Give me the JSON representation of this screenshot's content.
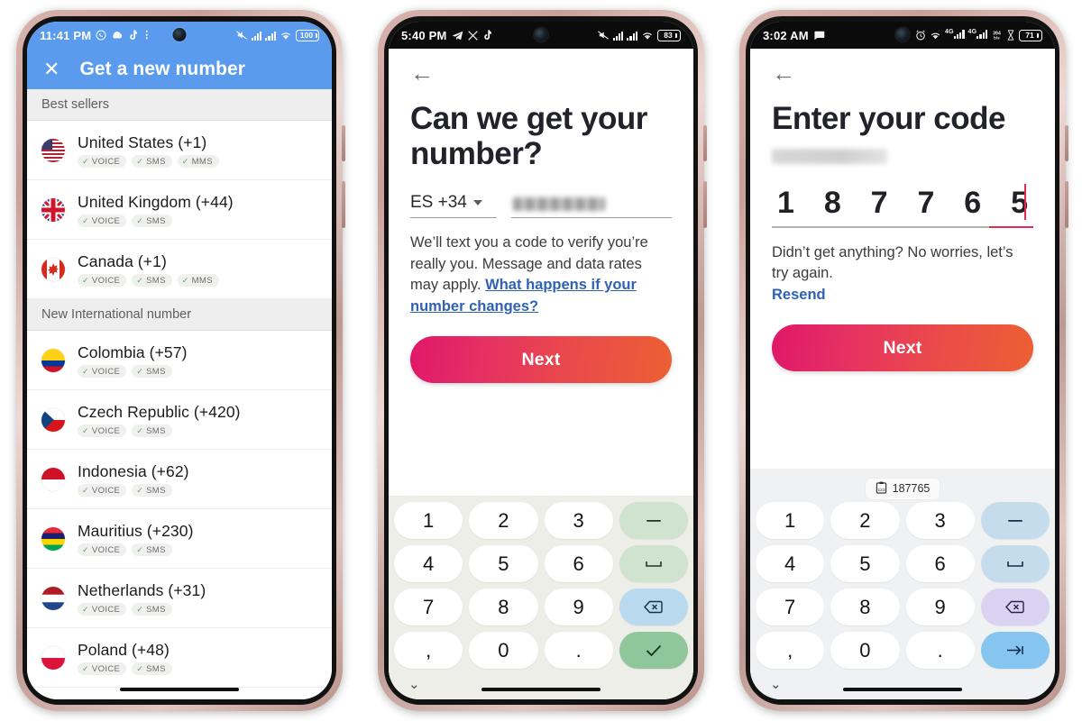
{
  "phones": [
    {
      "id": "phone-country-picker",
      "statusbar": {
        "theme": "blue",
        "time": "11:41 PM",
        "left_icons": [
          "whatsapp-icon",
          "cloud-icon",
          "tiktok-icon",
          "more-icon"
        ],
        "right_icons": [
          "mute-icon",
          "signal-1-icon",
          "signal-2-icon",
          "wifi-icon"
        ],
        "battery": "100"
      },
      "appbar": {
        "close_label": "✕",
        "title": "Get a new number"
      },
      "sections": [
        {
          "header": "Best sellers",
          "countries": [
            {
              "name": "United States (+1)",
              "flag": "us",
              "features": [
                "VOICE",
                "SMS",
                "MMS"
              ]
            },
            {
              "name": "United Kingdom (+44)",
              "flag": "gb",
              "features": [
                "VOICE",
                "SMS"
              ]
            },
            {
              "name": "Canada (+1)",
              "flag": "ca",
              "features": [
                "VOICE",
                "SMS",
                "MMS"
              ]
            }
          ]
        },
        {
          "header": "New International number",
          "countries": [
            {
              "name": "Colombia (+57)",
              "flag": "co",
              "features": [
                "VOICE",
                "SMS"
              ]
            },
            {
              "name": "Czech Republic (+420)",
              "flag": "cz",
              "features": [
                "VOICE",
                "SMS"
              ]
            },
            {
              "name": "Indonesia (+62)",
              "flag": "id",
              "features": [
                "VOICE",
                "SMS"
              ]
            },
            {
              "name": "Mauritius (+230)",
              "flag": "mu",
              "features": [
                "VOICE",
                "SMS"
              ]
            },
            {
              "name": "Netherlands (+31)",
              "flag": "nl",
              "features": [
                "VOICE",
                "SMS"
              ]
            },
            {
              "name": "Poland (+48)",
              "flag": "pl",
              "features": [
                "VOICE",
                "SMS"
              ]
            }
          ]
        }
      ]
    },
    {
      "id": "phone-enter-number",
      "statusbar": {
        "theme": "dark",
        "time": "5:40 PM",
        "left_icons": [
          "telegram-icon",
          "x-icon",
          "tiktok-icon"
        ],
        "right_icons": [
          "mute-icon",
          "signal-1-icon",
          "signal-2-icon",
          "wifi-icon"
        ],
        "battery": "83"
      },
      "back_label": "←",
      "title": "Can we get your number?",
      "country_code": "ES +34",
      "number_placeholder": "",
      "body_prefix": "We’ll text you a code to verify you’re really you. Message and data rates may apply. ",
      "body_link": "What happens if your number changes?",
      "cta_label": "Next",
      "keyboard": {
        "theme": "green",
        "keys": [
          "1",
          "2",
          "3",
          "4",
          "5",
          "6",
          "7",
          "8",
          "9",
          ",",
          "0",
          "."
        ],
        "fn_keys": [
          "minus-key",
          "space-key",
          "backspace-key",
          "confirm-key"
        ],
        "collapse_label": "⌄"
      }
    },
    {
      "id": "phone-enter-code",
      "statusbar": {
        "theme": "dark",
        "time": "3:02 AM",
        "left_icons": [
          "message-icon"
        ],
        "right_icons": [
          "alarm-icon",
          "wifi-icon",
          "signal-4g-1-icon",
          "signal-4g-2-icon",
          "data-rate-icon",
          "hourglass-icon"
        ],
        "battery": "71"
      },
      "back_label": "←",
      "title": "Enter your code",
      "subtitle_redacted": true,
      "code_digits": [
        "1",
        "8",
        "7",
        "7",
        "6",
        "5"
      ],
      "resend_text": "Didn’t get anything? No worries, let’s try again.",
      "resend_link": "Resend",
      "cta_label": "Next",
      "keyboard": {
        "theme": "grey",
        "suggestion": "187765",
        "suggestion_icon": "clipboard-123-icon",
        "keys": [
          "1",
          "2",
          "3",
          "4",
          "5",
          "6",
          "7",
          "8",
          "9",
          ",",
          "0",
          "."
        ],
        "fn_keys": [
          "minus-key",
          "space-key",
          "backspace-key",
          "tab-key"
        ],
        "collapse_label": "⌄"
      }
    }
  ],
  "colors": {
    "appbar_blue": "#5a9bee",
    "cta_gradient_start": "#e0176a",
    "cta_gradient_end": "#ec5f33",
    "link_blue": "#2f62b3",
    "code_active": "#e02b4e"
  }
}
